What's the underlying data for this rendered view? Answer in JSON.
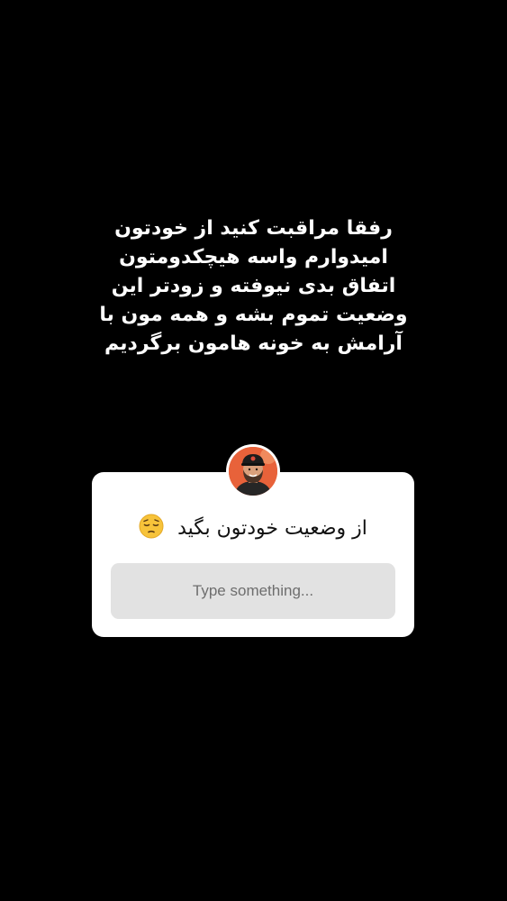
{
  "story": {
    "lines": [
      "رفقا مراقبت کنید از خودتون",
      "امیدوارم واسه هیچکدومتون",
      "اتفاق بدی نیوفته و زودتر این",
      "وضعیت  تموم بشه و همه مون با",
      "آرامش به خونه هامون برگردیم"
    ]
  },
  "question_sticker": {
    "avatar_icon": "profile-avatar",
    "question": "از وضعیت خودتون بگید",
    "emoji_icon": "pensive-face-emoji",
    "answer_placeholder": "Type something..."
  },
  "colors": {
    "background": "#000000",
    "text": "#ffffff",
    "card": "#ffffff",
    "input": "#e2e2e2",
    "placeholder": "#6e6e6e"
  }
}
